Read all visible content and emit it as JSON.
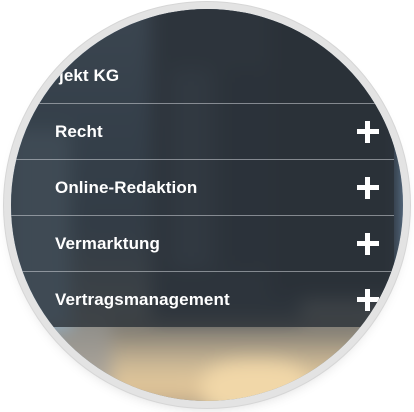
{
  "menu": {
    "items": [
      {
        "label": "jekt KG",
        "has_expand": false
      },
      {
        "label": "Recht",
        "has_expand": true,
        "expand_icon": "plus-icon"
      },
      {
        "label": "Online-Redaktion",
        "has_expand": true,
        "expand_icon": "plus-icon"
      },
      {
        "label": "Vermarktung",
        "has_expand": true,
        "expand_icon": "plus-icon"
      },
      {
        "label": "Vertragsmanagement",
        "has_expand": true,
        "expand_icon": "plus-icon"
      }
    ]
  },
  "colors": {
    "panel": "#2b3137",
    "text": "#ffffff",
    "divider": "#cdd2d7"
  }
}
